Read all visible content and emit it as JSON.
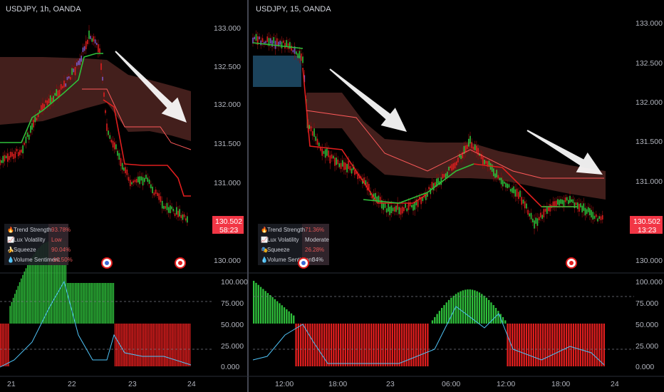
{
  "panels": [
    {
      "title": "USDJPY, 1h, OANDA",
      "y_ticks": [
        "133.000",
        "132.500",
        "132.000",
        "131.500",
        "131.000",
        "130.000"
      ],
      "x_ticks": [
        "21",
        "22",
        "23",
        "24"
      ],
      "price_tag": {
        "price": "130.502",
        "countdown": "58:23"
      },
      "osc_ticks": [
        "100.000",
        "75.000",
        "50.000",
        "25.000",
        "0.000"
      ],
      "table": [
        {
          "icon": "fire-icon",
          "label": "Trend Strength",
          "value": "93.78%"
        },
        {
          "icon": "chart-icon",
          "label": "Lux Volatility",
          "value": "Low"
        },
        {
          "icon": "squeeze-icon",
          "label": "Squeeze",
          "value": "90.04%"
        },
        {
          "icon": "drop-icon",
          "label": "Volume Sentiment",
          "value": "-10.50%"
        }
      ],
      "chart_data": {
        "type": "line",
        "symbol": "USDJPY",
        "timeframe": "1h",
        "x": [
          "21",
          "22",
          "23",
          "24"
        ],
        "ylim": [
          130.0,
          133.0
        ]
      }
    },
    {
      "title": "USDJPY, 15, OANDA",
      "y_ticks": [
        "133.000",
        "132.500",
        "132.000",
        "131.500",
        "131.000",
        "130.000"
      ],
      "x_ticks": [
        "12:00",
        "18:00",
        "23",
        "06:00",
        "12:00",
        "18:00",
        "24"
      ],
      "price_tag": {
        "price": "130.502",
        "countdown": "13:23"
      },
      "osc_ticks": [
        "100.000",
        "75.000",
        "50.000",
        "25.000",
        "0.000"
      ],
      "table": [
        {
          "icon": "fire-icon",
          "label": "Trend Strength",
          "value": "71.36%"
        },
        {
          "icon": "chart-icon",
          "label": "Lux Volatility",
          "value": "Moderate"
        },
        {
          "icon": "squeeze-icon",
          "label": "Squeeze",
          "value": "26.28%"
        },
        {
          "icon": "drop-icon",
          "label": "Volume Sentiment",
          "value": "34%"
        }
      ],
      "chart_data": {
        "type": "line",
        "symbol": "USDJPY",
        "timeframe": "15",
        "x": [
          "12:00",
          "18:00",
          "23",
          "06:00",
          "12:00",
          "18:00",
          "24"
        ],
        "ylim": [
          130.0,
          133.0
        ]
      }
    }
  ],
  "colors": {
    "bull": "#2fbf3b",
    "bear": "#e01e1e",
    "cloud": "#5a2a25",
    "arrow": "#ffffff",
    "tag": "#f23645",
    "wave": "#4fc3f7",
    "purple": "#7e57c2",
    "blue_box": "#1e4a66"
  }
}
